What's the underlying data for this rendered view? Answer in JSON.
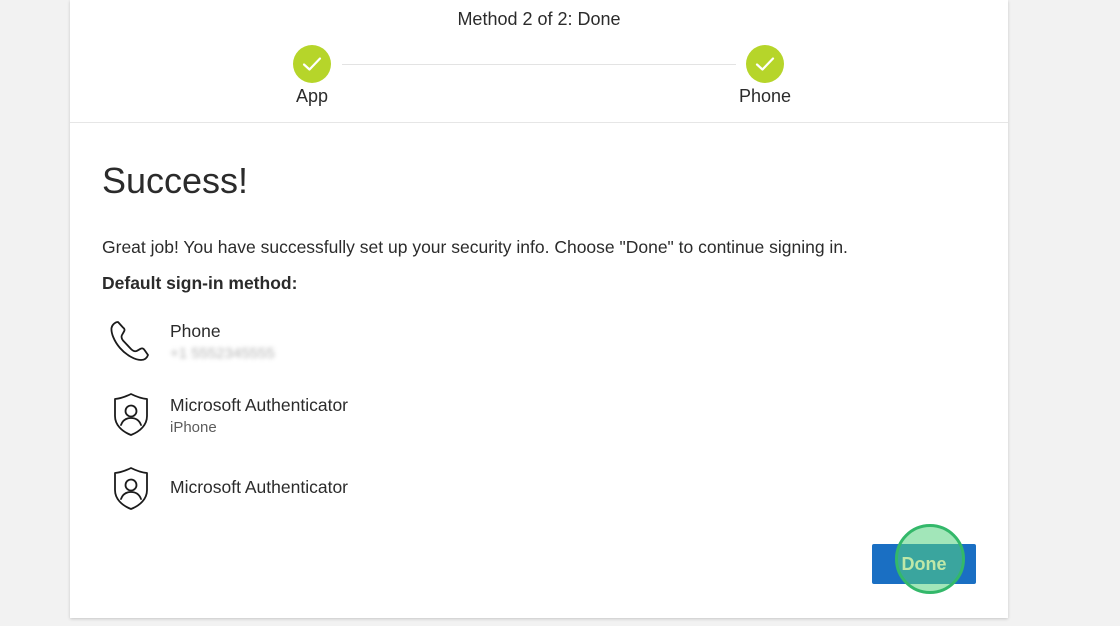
{
  "header": {
    "method_title": "Method 2 of 2: Done",
    "steps": [
      {
        "label": "App",
        "icon": "checkmark-icon",
        "status": "complete"
      },
      {
        "label": "Phone",
        "icon": "checkmark-icon",
        "status": "complete"
      }
    ]
  },
  "content": {
    "heading": "Success!",
    "message": "Great job! You have successfully set up your security info. Choose \"Done\" to continue signing in.",
    "default_label": "Default sign-in method:",
    "methods": [
      {
        "name": "Phone",
        "detail": "+1 5552345555",
        "icon": "phone-icon"
      },
      {
        "name": "Microsoft Authenticator",
        "detail": "iPhone",
        "icon": "authenticator-lock-icon"
      },
      {
        "name": "Microsoft Authenticator",
        "detail": "",
        "icon": "authenticator-lock-icon"
      }
    ]
  },
  "footer": {
    "done_label": "Done"
  },
  "colors": {
    "step_complete": "#b6d52a",
    "primary_button": "#1a6fc3",
    "click_indicator": "#33b86a"
  }
}
